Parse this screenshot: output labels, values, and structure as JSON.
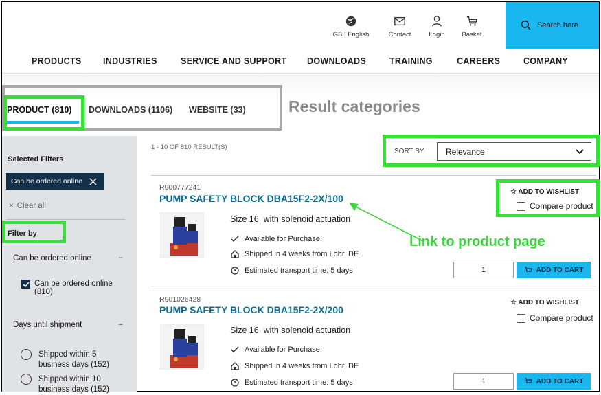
{
  "header": {
    "language": "GB | English",
    "contact": "Contact",
    "login": "Login",
    "basket": "Basket",
    "search_placeholder": "Search here"
  },
  "nav": [
    "PRODUCTS",
    "INDUSTRIES",
    "SERVICE AND SUPPORT",
    "DOWNLOADS",
    "TRAINING",
    "CAREERS",
    "COMPANY"
  ],
  "tabs": [
    "PRODUCT (810)",
    "DOWNLOADS (1106)",
    "WEBSITE (33)"
  ],
  "annotations": {
    "result_categories": "Result categories",
    "link_to_product": "Link to product page",
    "highlight_color": "#33e233",
    "category_box_color": "#a8a8a8"
  },
  "sidebar": {
    "selected_filters": "Selected Filters",
    "chip": "Can be ordered online",
    "clear_all": "Clear all",
    "filter_by": "Filter by",
    "group1_title": "Can be ordered online",
    "group1_option": "Can be ordered online (810)",
    "group2_title": "Days until shipment",
    "group2_options": [
      "Shipped within 5 business days (152)",
      "Shipped within 10 business days (152)"
    ]
  },
  "results": {
    "count": "1 - 10 OF 810 RESULT(S)",
    "sort_label": "SORT BY",
    "sort_value": "Relevance",
    "accent": "#1ab6f0",
    "items": [
      {
        "id": "R900777241",
        "title": "PUMP SAFETY BLOCK DBA15F2-2X/100",
        "description": "Size 16, with solenoid actuation",
        "availability": "Available for Purchase.",
        "shipping": "Shipped in 4 weeks from Lohr, DE",
        "transport": "Estimated transport time: 5 days",
        "wishlist": "ADD TO WISHLIST",
        "compare": "Compare product",
        "quantity": "1",
        "add_to_cart": "ADD TO CART"
      },
      {
        "id": "R901026428",
        "title": "PUMP SAFETY BLOCK DBA15F2-2X/200",
        "description": "Size 16, with solenoid actuation",
        "availability": "Available for Purchase.",
        "shipping": "Shipped in 4 weeks from Lohr, DE",
        "transport": "Estimated transport time: 5 days",
        "wishlist": "ADD TO WISHLIST",
        "compare": "Compare product",
        "quantity": "1",
        "add_to_cart": "ADD TO CART"
      }
    ]
  }
}
